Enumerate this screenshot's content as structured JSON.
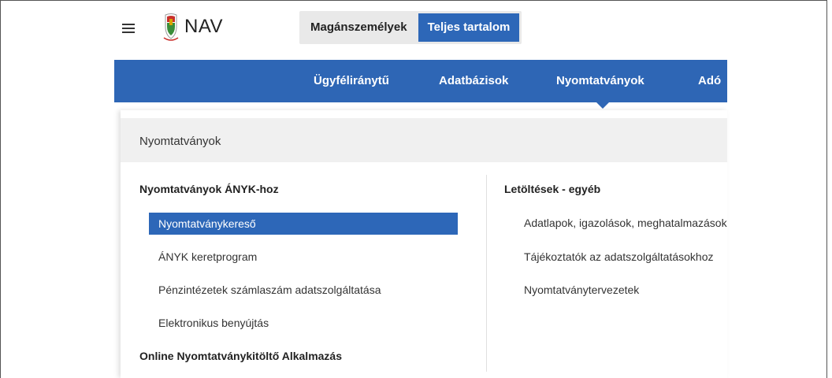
{
  "header": {
    "logo_text": "NAV",
    "segments": [
      {
        "label": "Magánszemélyek"
      },
      {
        "label": "Teljes tartalom"
      }
    ]
  },
  "nav": {
    "items": [
      "Ügyféliránytű",
      "Adatbázisok",
      "Nyomtatványok",
      "Adó"
    ]
  },
  "panel": {
    "title": "Nyomtatványok",
    "left": {
      "heading": "Nyomtatványok ÁNYK-hoz",
      "links": [
        "Nyomtatványkereső",
        "ÁNYK keretprogram",
        "Pénzintézetek számlaszám adatszolgáltatása",
        "Elektronikus benyújtás"
      ],
      "heading2": "Online Nyomtatványkitöltő Alkalmazás"
    },
    "right": {
      "heading": "Letöltések - egyéb",
      "links": [
        "Adatlapok, igazolások, meghatalmazások",
        "Tájékoztatók az adatszolgáltatásokhoz",
        "Nyomtatványtervezetek"
      ]
    }
  },
  "colors": {
    "brand_blue": "#2e66b5",
    "panel_header_bg": "#f0f0f0"
  }
}
